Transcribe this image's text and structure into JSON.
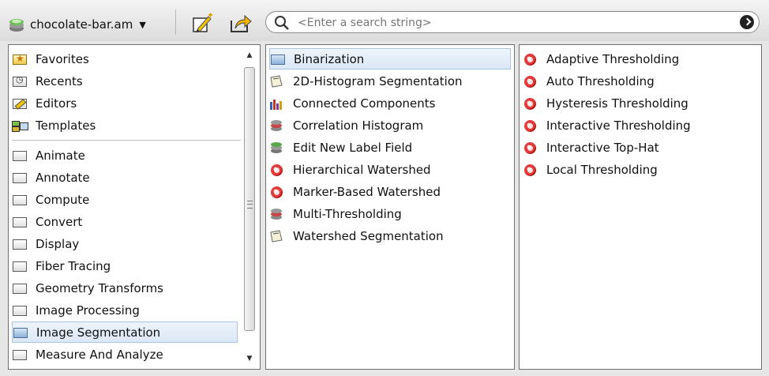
{
  "toolbar": {
    "data_label": "chocolate-bar.am",
    "search_placeholder": "<Enter a search string>"
  },
  "categories": {
    "quick": [
      {
        "label": "Favorites",
        "icon": "favorites-star-icon"
      },
      {
        "label": "Recents",
        "icon": "clock-icon"
      },
      {
        "label": "Editors",
        "icon": "pencil-icon"
      },
      {
        "label": "Templates",
        "icon": "template-icon"
      }
    ],
    "folders": [
      {
        "label": "Animate"
      },
      {
        "label": "Annotate"
      },
      {
        "label": "Compute"
      },
      {
        "label": "Convert"
      },
      {
        "label": "Display"
      },
      {
        "label": "Fiber Tracing"
      },
      {
        "label": "Geometry Transforms"
      },
      {
        "label": "Image Processing"
      },
      {
        "label": "Image Segmentation",
        "selected": true
      },
      {
        "label": "Measure And Analyze"
      }
    ]
  },
  "subcategories": [
    {
      "label": "Binarization",
      "icon": "folder-icon",
      "selected": true
    },
    {
      "label": "2D-Histogram Segmentation",
      "icon": "segmentation-icon"
    },
    {
      "label": "Connected Components",
      "icon": "bars-icon"
    },
    {
      "label": "Correlation Histogram",
      "icon": "stack-icon"
    },
    {
      "label": "Edit New Label Field",
      "icon": "label-field-icon"
    },
    {
      "label": "Hierarchical Watershed",
      "icon": "red-module-icon"
    },
    {
      "label": "Marker-Based Watershed",
      "icon": "red-module-icon"
    },
    {
      "label": "Multi-Thresholding",
      "icon": "stack-icon"
    },
    {
      "label": "Watershed Segmentation",
      "icon": "segmentation-icon"
    }
  ],
  "modules": [
    {
      "label": "Adaptive Thresholding"
    },
    {
      "label": "Auto Thresholding"
    },
    {
      "label": "Hysteresis Thresholding"
    },
    {
      "label": "Interactive Thresholding"
    },
    {
      "label": "Interactive Top-Hat"
    },
    {
      "label": "Local Thresholding"
    }
  ]
}
